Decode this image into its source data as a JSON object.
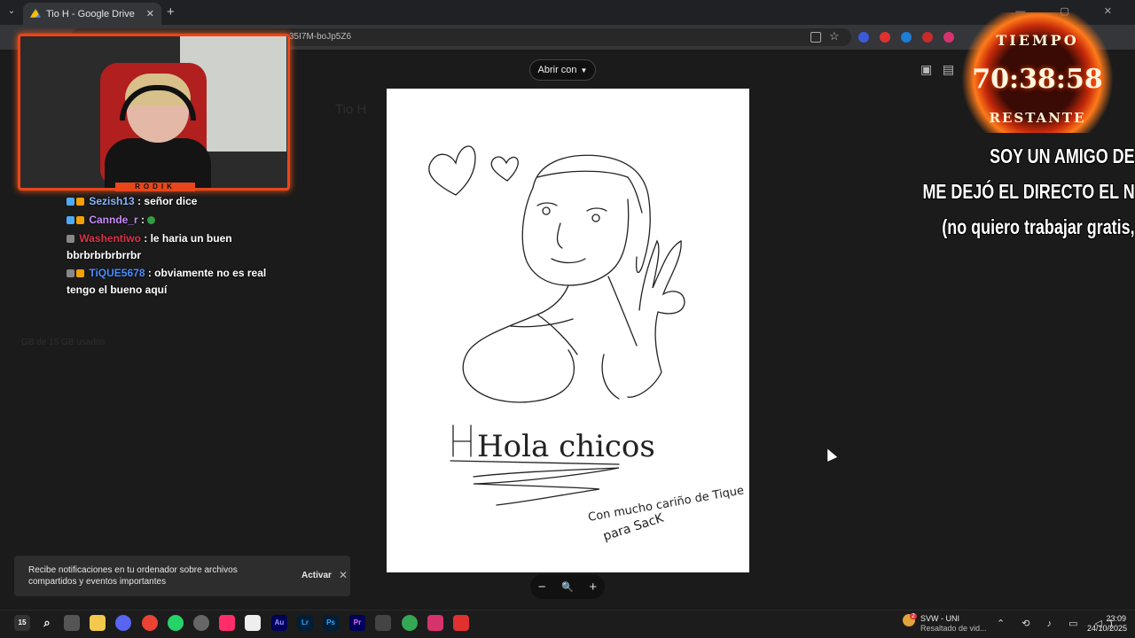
{
  "browser": {
    "tab_title": "Tio H - Google Drive",
    "tab_close": "✕",
    "new_tab": "+",
    "url_fragment": "35I7M-boJp5Z6",
    "window_controls": "— ▢ ✕"
  },
  "viewer": {
    "open_with_label": "Abrir con",
    "zoom_out": "−",
    "zoom_icon": "🔍",
    "zoom_in": "+",
    "background_title": "Tio H",
    "sidebar_storage": "GB de 15 GB usados"
  },
  "drawing": {
    "greeting": "Hola chicos",
    "dedication_line1": "Con mucho cariño de Tique",
    "dedication_line2": "para SacK"
  },
  "notification": {
    "message": "Recibe notificaciones en tu ordenador sobre archivos compartidos y eventos importantes",
    "activate_label": "Activar",
    "close": "✕"
  },
  "stream": {
    "webcam_label": "RODIK",
    "chat": [
      {
        "user": "Sezish13",
        "user_color": "#8ab4f8",
        "message": "señor dice"
      },
      {
        "user": "Cannde_r",
        "user_color": "#c58af9",
        "message": ""
      },
      {
        "user": "Washentiwo",
        "user_color": "#e0304a",
        "message": "le haria un buen bbrbrbrbrbrrbr"
      },
      {
        "user": "TiQUE5678",
        "user_color": "#4a8cff",
        "message": "obviamente no es real tengo el bueno aquí"
      }
    ],
    "timer": {
      "title": "TIEMPO",
      "value": "70:38:58",
      "subtitle": "RESTANTE"
    },
    "overlay_lines": [
      "SOY UN AMIGO DE",
      "ME DEJÓ EL DIRECTO EL N",
      "(no quiero trabajar gratis,"
    ]
  },
  "taskbar": {
    "weather_title": "SVW - UNI",
    "weather_subtitle": "Resaltado de vid...",
    "weather_badge": "2",
    "clock_time": "23:09",
    "clock_date": "24/10/2025",
    "apps": [
      "start",
      "search",
      "task-view",
      "explorer",
      "discord",
      "chrome",
      "whatsapp",
      "app",
      "tiktok",
      "capcut",
      "audition",
      "lightroom",
      "photoshop",
      "premiere",
      "terminal",
      "chrome-active",
      "app-red",
      "app-red-active"
    ]
  },
  "colors": {
    "accent_fire": "#e8461a",
    "drive_bg": "#2a2a2a"
  }
}
